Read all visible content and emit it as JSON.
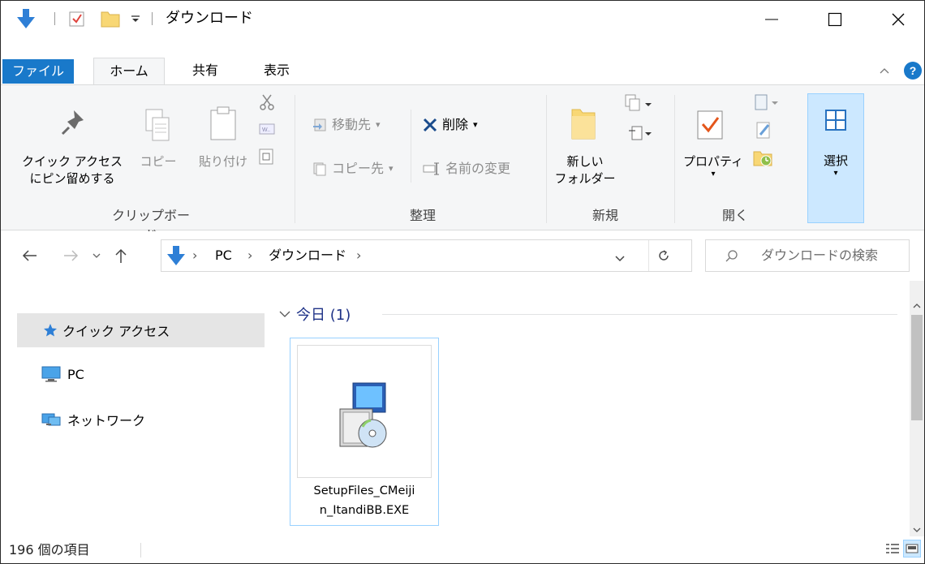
{
  "window": {
    "title": "ダウンロード",
    "minimize_glyph": "—",
    "close_glyph": "✕"
  },
  "tabs": {
    "file": "ファイル",
    "home": "ホーム",
    "share": "共有",
    "view": "表示"
  },
  "ribbon": {
    "pin_line1": "クイック アクセス",
    "pin_line2": "にピン留めする",
    "copy": "コピー",
    "paste": "貼り付け",
    "group_clipboard": "クリップボード",
    "move_to": "移動先",
    "copy_to": "コピー先",
    "delete": "削除",
    "rename": "名前の変更",
    "group_organize": "整理",
    "new_folder_line1": "新しい",
    "new_folder_line2": "フォルダー",
    "group_new": "新規",
    "properties": "プロパティ",
    "group_open": "開く",
    "select": "選択"
  },
  "address": {
    "pc": "PC",
    "downloads": "ダウンロード",
    "search_placeholder": "ダウンロードの検索"
  },
  "nav": {
    "quick_access": "クイック アクセス",
    "pc": "PC",
    "network": "ネットワーク"
  },
  "content": {
    "group_header": "今日 (1)",
    "file_line1": "SetupFiles_CMeiji",
    "file_line2": "n_ItandiBB.EXE"
  },
  "status": {
    "item_count": "196 個の項目"
  },
  "colors": {
    "accent_blue": "#1979ca",
    "selection_blue": "#99d1ff",
    "folder_yellow": "#f8d775"
  }
}
